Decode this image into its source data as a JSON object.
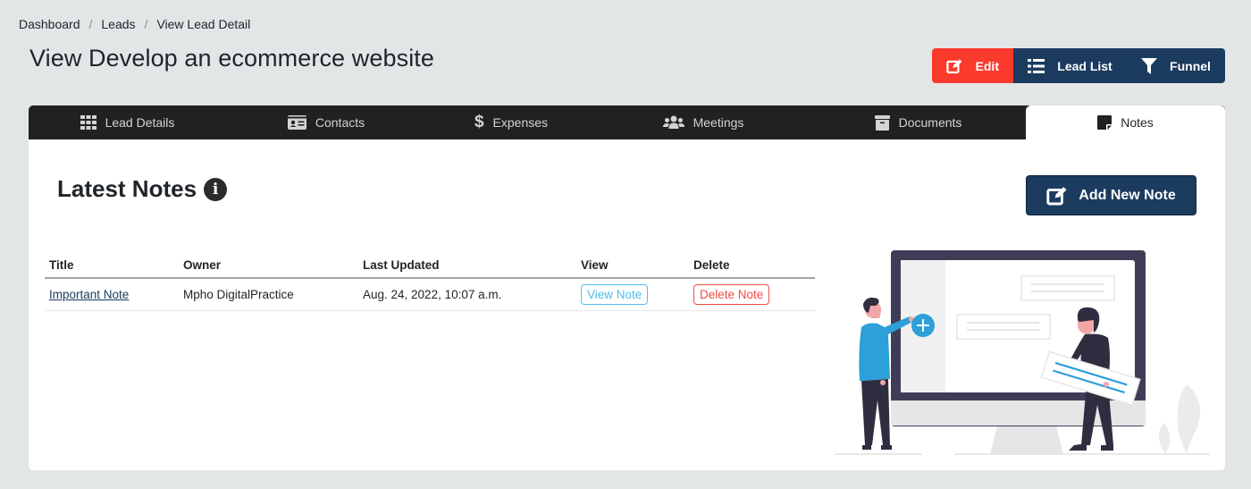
{
  "breadcrumb": {
    "items": [
      "Dashboard",
      "Leads",
      "View Lead Detail"
    ],
    "separator": "/"
  },
  "page_title": "View Develop an ecommerce website",
  "actions": {
    "edit": "Edit",
    "lead_list": "Lead List",
    "funnel": "Funnel"
  },
  "tabs": [
    {
      "label": "Lead Details",
      "icon": "grid-icon"
    },
    {
      "label": "Contacts",
      "icon": "id-card-icon"
    },
    {
      "label": "Expenses",
      "icon": "dollar-icon"
    },
    {
      "label": "Meetings",
      "icon": "users-icon"
    },
    {
      "label": "Documents",
      "icon": "archive-icon"
    },
    {
      "label": "Notes",
      "icon": "sticky-note-icon",
      "active": true
    }
  ],
  "notes": {
    "title": "Latest Notes",
    "info_icon": "i",
    "add_button": "Add New Note",
    "columns": [
      "Title",
      "Owner",
      "Last Updated",
      "View",
      "Delete"
    ],
    "rows": [
      {
        "title": "Important Note",
        "owner": "Mpho DigitalPractice",
        "last_updated": "Aug. 24, 2022, 10:07 a.m.",
        "view_label": "View Note",
        "delete_label": "Delete Note"
      }
    ]
  },
  "colors": {
    "edit": "#fa3a2d",
    "primary": "#1b3b5f",
    "tabbar": "#212121",
    "view": "#4fbfe8",
    "delete": "#f24b45",
    "illustration_accent": "#2d9fd9"
  }
}
